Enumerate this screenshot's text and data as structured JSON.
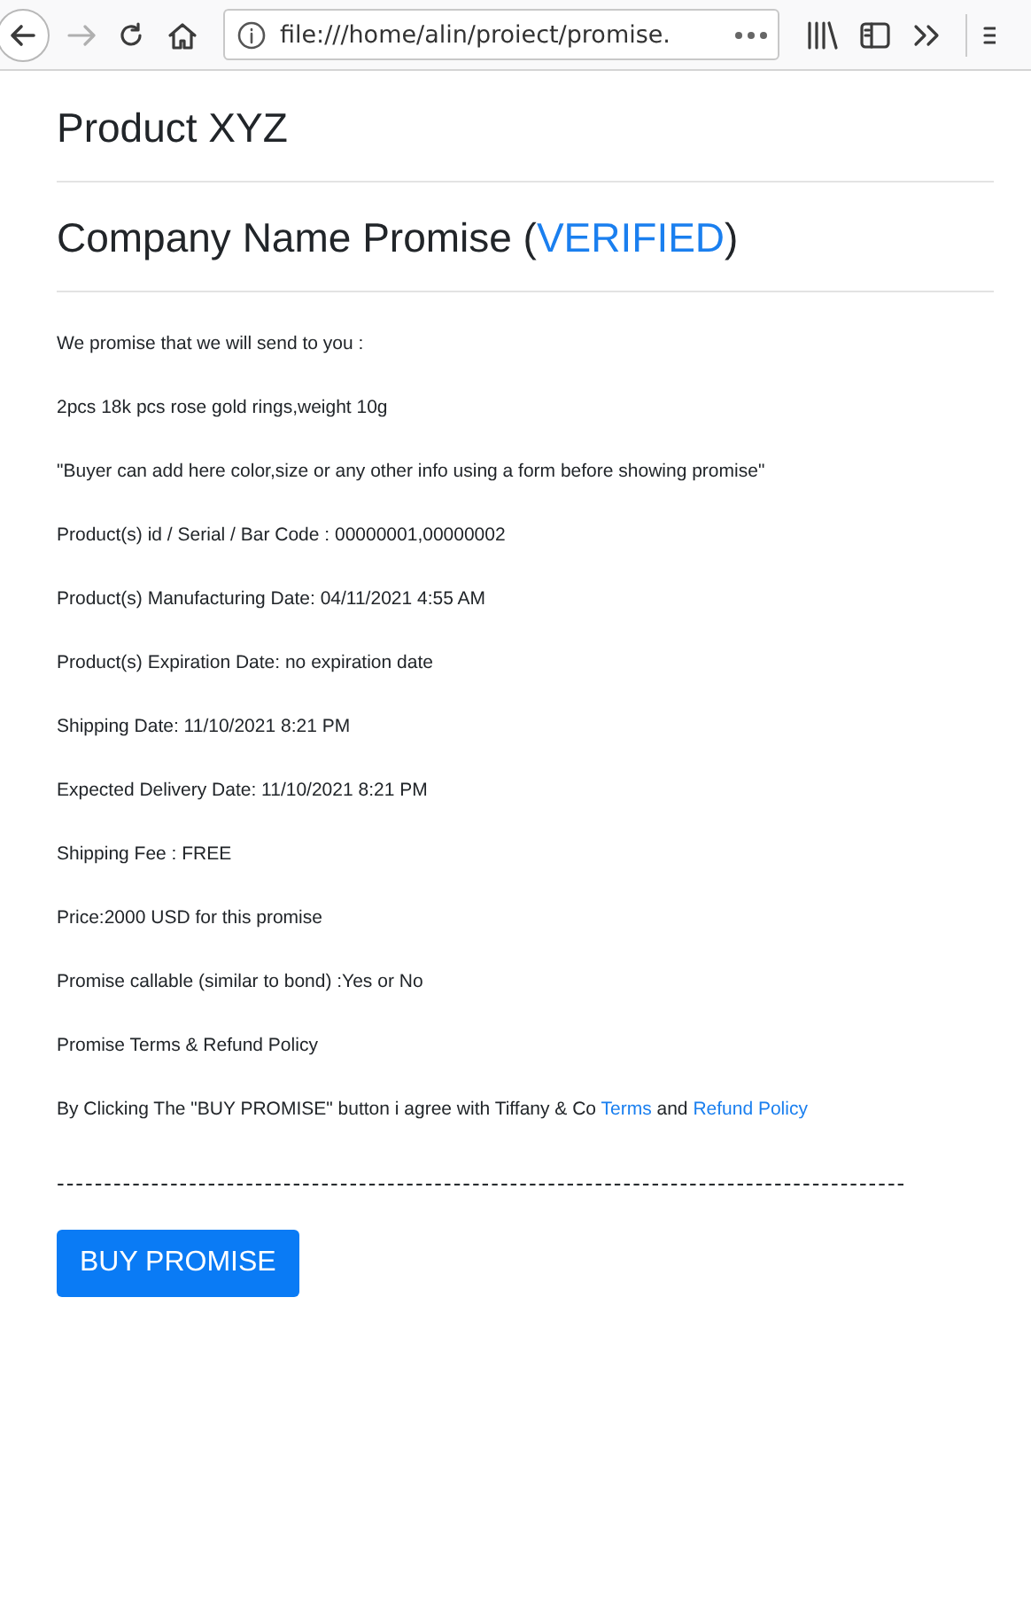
{
  "browser": {
    "url": "file:///home/alin/proiect/promise.",
    "forward_disabled": true
  },
  "product_title": "Product XYZ",
  "promise_title": {
    "prefix": "Company Name Promise (",
    "highlight": "VERIFIED",
    "suffix": ")"
  },
  "lines": [
    "We promise that we will send to you :",
    "2pcs 18k pcs rose gold rings,weight 10g",
    "\"Buyer can add here color,size or any other info using a form before showing promise\"",
    "Product(s) id / Serial / Bar Code : 00000001,00000002",
    "Product(s) Manufacturing Date: 04/11/2021 4:55 AM",
    "Product(s) Expiration Date: no expiration date",
    "Shipping Date: 11/10/2021 8:21 PM",
    "Expected Delivery Date: 11/10/2021 8:21 PM",
    "Shipping Fee : FREE",
    "Price:2000 USD for this promise",
    "Promise callable (similar to bond) :Yes or No",
    "Promise Terms & Refund Policy"
  ],
  "agreement": [
    {
      "kind": "text",
      "text": "By Clicking The \"BUY PROMISE\" button i agree with Tiffany & Co "
    },
    {
      "kind": "link",
      "text": "Terms"
    },
    {
      "kind": "text",
      "text": " and "
    },
    {
      "kind": "link",
      "text": "Refund Policy"
    }
  ],
  "separator": "------------------------------------------------------------------------------------------",
  "buy_button": "BUY PROMISE"
}
